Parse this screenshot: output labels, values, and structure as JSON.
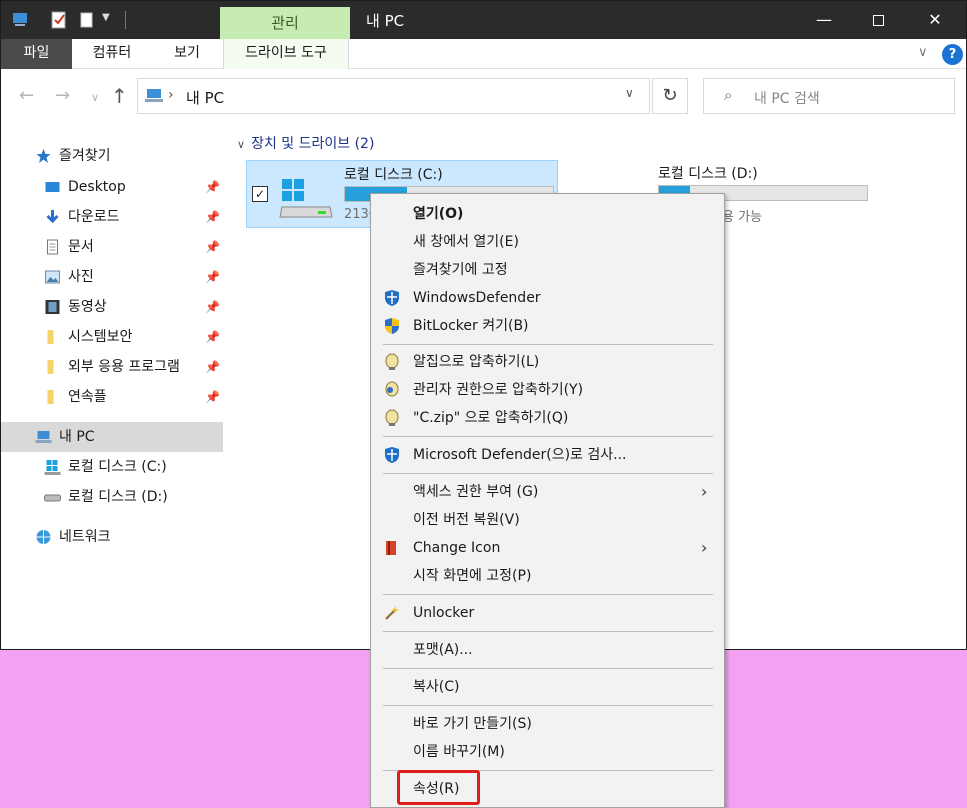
{
  "titlebar": {
    "context_tab": "관리",
    "window_title": "내 PC",
    "minimize": "—",
    "maximize": "",
    "close": "✕"
  },
  "ribbon": {
    "tabs": [
      "파일",
      "컴퓨터",
      "보기",
      "드라이브 도구"
    ],
    "collapse_chevron": "∨",
    "help": "?"
  },
  "address": {
    "back": "←",
    "forward": "→",
    "recent": "∨",
    "up": "↑",
    "chevron": "›",
    "path": "내 PC",
    "dropdown": "∨",
    "refresh": "↻"
  },
  "search": {
    "placeholder": "내 PC 검색",
    "icon": "⌕"
  },
  "sidebar": {
    "pin_glyph": "📌",
    "quick_access": "즐겨찾기",
    "pinned": [
      "Desktop",
      "다운로드",
      "문서",
      "사진",
      "동영상",
      "시스템보안",
      "외부 응용 프로그램",
      "연속플"
    ],
    "this_pc": "내 PC",
    "drives": [
      "로컬 디스크 (C:)",
      "로컬 디스크 (D:)"
    ],
    "network": "네트워크"
  },
  "content": {
    "group_header": "장치 및 드라이브 (2)",
    "group_chevron": "∨",
    "drives": [
      {
        "name": "로컬 디스크 (C:)",
        "free_text": "213G",
        "usage": 0.3,
        "checked": "✓"
      },
      {
        "name": "로컬 디스크 (D:)",
        "free_text": "6.59GB 사용 가능",
        "usage": 0.15
      }
    ]
  },
  "context_menu": {
    "items": [
      "열기(O)",
      "새 창에서 열기(E)",
      "즐겨찾기에 고정",
      "WindowsDefender",
      "BitLocker 켜기(B)",
      "알집으로 압축하기(L)",
      "관리자 권한으로 압축하기(Y)",
      "\"C.zip\" 으로 압축하기(Q)",
      "Microsoft Defender(으)로 검사...",
      "액세스 권한 부여 (G)",
      "이전 버전 복원(V)",
      "Change Icon",
      "시작 화면에 고정(P)",
      "Unlocker",
      "포맷(A)...",
      "복사(C)",
      "바로 가기 만들기(S)",
      "이름 바꾸기(M)",
      "속성(R)"
    ],
    "submenu_arrow": "›"
  },
  "colors": {
    "accent": "#26a0da",
    "selection": "#cce8ff",
    "context_tab": "#c7ecb1",
    "highlight": "#e11c1c",
    "background": "#f2a2f0"
  }
}
